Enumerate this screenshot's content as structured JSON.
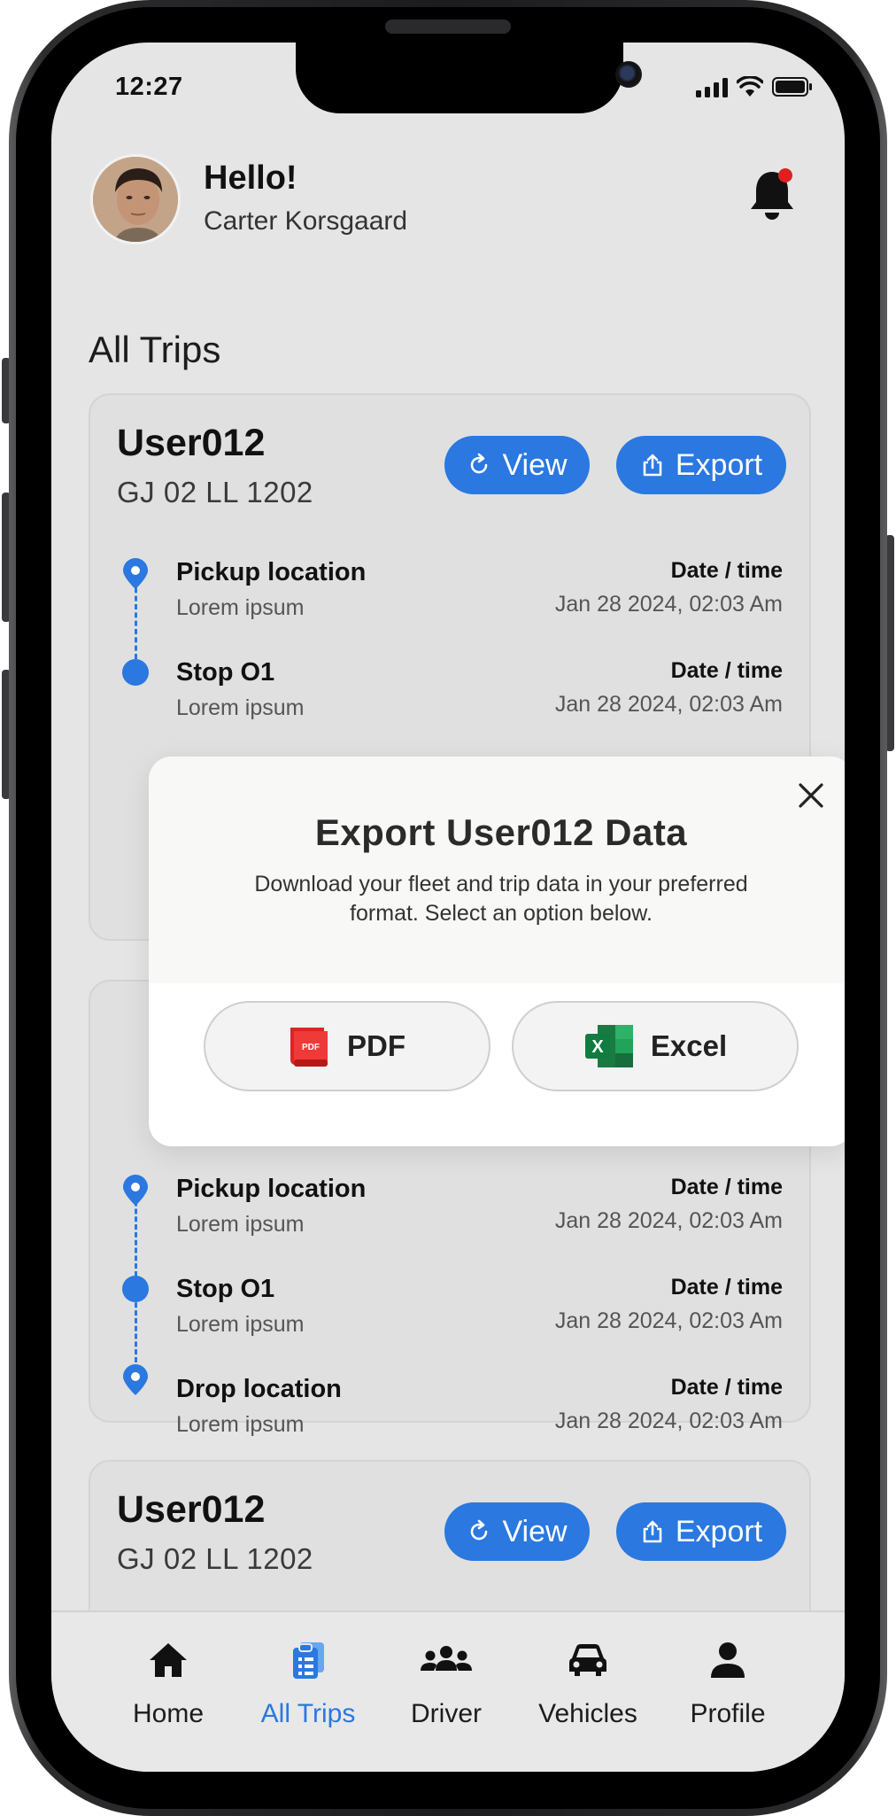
{
  "status_bar": {
    "time": "12:27"
  },
  "header": {
    "greeting": "Hello!",
    "user_name": "Carter Korsgaard"
  },
  "section_title": "All Trips",
  "cards": [
    {
      "user": "User012",
      "plate": "GJ 02 LL 1202",
      "view_label": "View",
      "export_label": "Export",
      "stops": [
        {
          "name": "Pickup location",
          "sub": "Lorem ipsum",
          "dt_label": "Date / time",
          "dt": "Jan 28 2024, 02:03 Am"
        },
        {
          "name": "Stop O1",
          "sub": "Lorem ipsum",
          "dt_label": "Date / time",
          "dt": "Jan 28 2024, 02:03 Am"
        }
      ]
    },
    {
      "stops": [
        {
          "name": "Pickup location",
          "sub": "Lorem ipsum",
          "dt_label": "Date / time",
          "dt": "Jan 28 2024, 02:03 Am"
        },
        {
          "name": "Stop O1",
          "sub": "Lorem ipsum",
          "dt_label": "Date / time",
          "dt": "Jan 28 2024, 02:03 Am"
        },
        {
          "name": "Drop location",
          "sub": "Lorem ipsum",
          "dt_label": "Date / time",
          "dt": "Jan 28 2024, 02:03 Am"
        }
      ]
    },
    {
      "user": "User012",
      "plate": "GJ 02 LL 1202",
      "view_label": "View",
      "export_label": "Export"
    }
  ],
  "modal": {
    "title": "Export User012 Data",
    "description": "Download your fleet and trip data in your preferred format. Select an option below.",
    "pdf_label": "PDF",
    "pdf_icon_text": "PDF",
    "excel_label": "Excel",
    "excel_icon_text": "X"
  },
  "nav": [
    {
      "label": "Home",
      "icon": "home-icon"
    },
    {
      "label": "All Trips",
      "icon": "clipboard-icon",
      "active": true
    },
    {
      "label": "Driver",
      "icon": "group-icon"
    },
    {
      "label": "Vehicles",
      "icon": "car-icon"
    },
    {
      "label": "Profile",
      "icon": "person-icon"
    }
  ],
  "colors": {
    "accent": "#2a78e0",
    "background": "#e5e5e5",
    "notification_dot": "#e02020",
    "pdf_red": "#e02424",
    "excel_green": "#1f8a4c"
  }
}
